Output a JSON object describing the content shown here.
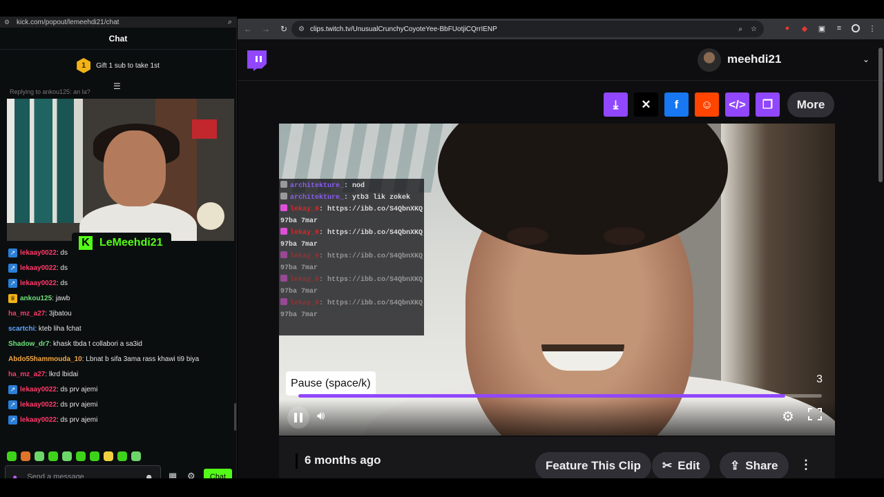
{
  "left_window": {
    "url": "kick.com/popout/lemeehdi21/chat",
    "chat_title": "Chat",
    "gift_badge_number": "1",
    "gift_text": "Gift 1 sub to take 1st",
    "reply_line": "Replying to ankou125: an la?",
    "streamer_name": "LeMeehdi21",
    "messages": [
      {
        "user": "lekaay0022",
        "color": "#ff3a6b",
        "badge": "blue",
        "text": ": ds"
      },
      {
        "user": "lekaay0022",
        "color": "#ff3a6b",
        "badge": "blue",
        "text": ": ds"
      },
      {
        "user": "lekaay0022",
        "color": "#ff3a6b",
        "badge": "blue",
        "text": ": ds"
      },
      {
        "user": "ankou125",
        "color": "#6ee27c",
        "badge": "gold",
        "text": ": jawb"
      },
      {
        "user": "ha_mz_a27",
        "color": "#ff3a6b",
        "badge": "",
        "text": ": 3jbatou"
      },
      {
        "user": "scartchi",
        "color": "#5fa8ff",
        "badge": "",
        "text": ": kteb liha fchat"
      },
      {
        "user": "Shadow_dr7",
        "color": "#6ee27c",
        "badge": "",
        "text": ": khask tbda t collabori a sa3id"
      },
      {
        "user": "Abdo55hammouda_10",
        "color": "#f5a742",
        "badge": "",
        "text": ": Lbnat b sifa 3ama rass khawi ti9 biya"
      },
      {
        "user": "ha_mz_a27",
        "color": "#ff3a6b",
        "badge": "",
        "text": ": lkrd lbidai"
      },
      {
        "user": "lekaay0022",
        "color": "#ff3a6b",
        "badge": "blue",
        "text": ": ds prv ajemi"
      },
      {
        "user": "lekaay0022",
        "color": "#ff3a6b",
        "badge": "blue",
        "text": ": ds prv ajemi"
      },
      {
        "user": "lekaay0022",
        "color": "#ff3a6b",
        "badge": "blue",
        "text": ": ds prv ajemi"
      }
    ],
    "composer_placeholder": "Send a message",
    "send_label": "Chat"
  },
  "right_window": {
    "url": "clips.twitch.tv/UnusualCrunchyCoyoteYee-BbFUotjiCQrrIENP",
    "channel_name": "meehdi21",
    "more_label": "More",
    "overlay_chat": [
      {
        "user": "architekture_",
        "ucolor": "p",
        "text": "nod",
        "icon": "grey",
        "faded": false
      },
      {
        "user": "architekture_",
        "ucolor": "p",
        "text": "ytb3 lik zokek",
        "icon": "grey",
        "faded": false
      },
      {
        "user": "lekay_0",
        "ucolor": "r",
        "text": "https://ibb.co/S4QbnXKQ",
        "icon": "pink",
        "faded": false
      },
      {
        "user": "",
        "ucolor": "",
        "text": "97ba 7mar",
        "icon": "",
        "faded": false
      },
      {
        "user": "lekay_0",
        "ucolor": "r",
        "text": "https://ibb.co/S4QbnXKQ",
        "icon": "pink",
        "faded": false
      },
      {
        "user": "",
        "ucolor": "",
        "text": "97ba 7mar",
        "icon": "",
        "faded": false
      },
      {
        "user": "lekay_0",
        "ucolor": "r",
        "text": "https://ibb.co/S4QbnXKQ",
        "icon": "pink",
        "faded": true
      },
      {
        "user": "",
        "ucolor": "",
        "text": "97ba 7mar",
        "icon": "",
        "faded": true
      },
      {
        "user": "lekay_0",
        "ucolor": "r",
        "text": "https://ibb.co/S4QbnXKQ",
        "icon": "pink",
        "faded": true
      },
      {
        "user": "",
        "ucolor": "",
        "text": "97ba 7mar",
        "icon": "",
        "faded": true
      },
      {
        "user": "lekay_0",
        "ucolor": "r",
        "text": "https://ibb.co/S4QbnXKQ",
        "icon": "pink",
        "faded": true
      },
      {
        "user": "",
        "ucolor": "",
        "text": "97ba 7mar",
        "icon": "",
        "faded": true
      }
    ],
    "tooltip": "Pause (space/k)",
    "clip_counter": "3",
    "progress_fraction": 0.93,
    "clip_age": "6 months ago",
    "feature_label": "Feature This Clip",
    "edit_label": "Edit",
    "share_label": "Share"
  },
  "colors": {
    "kick_green": "#53fc18",
    "twitch_purple": "#9147ff"
  }
}
